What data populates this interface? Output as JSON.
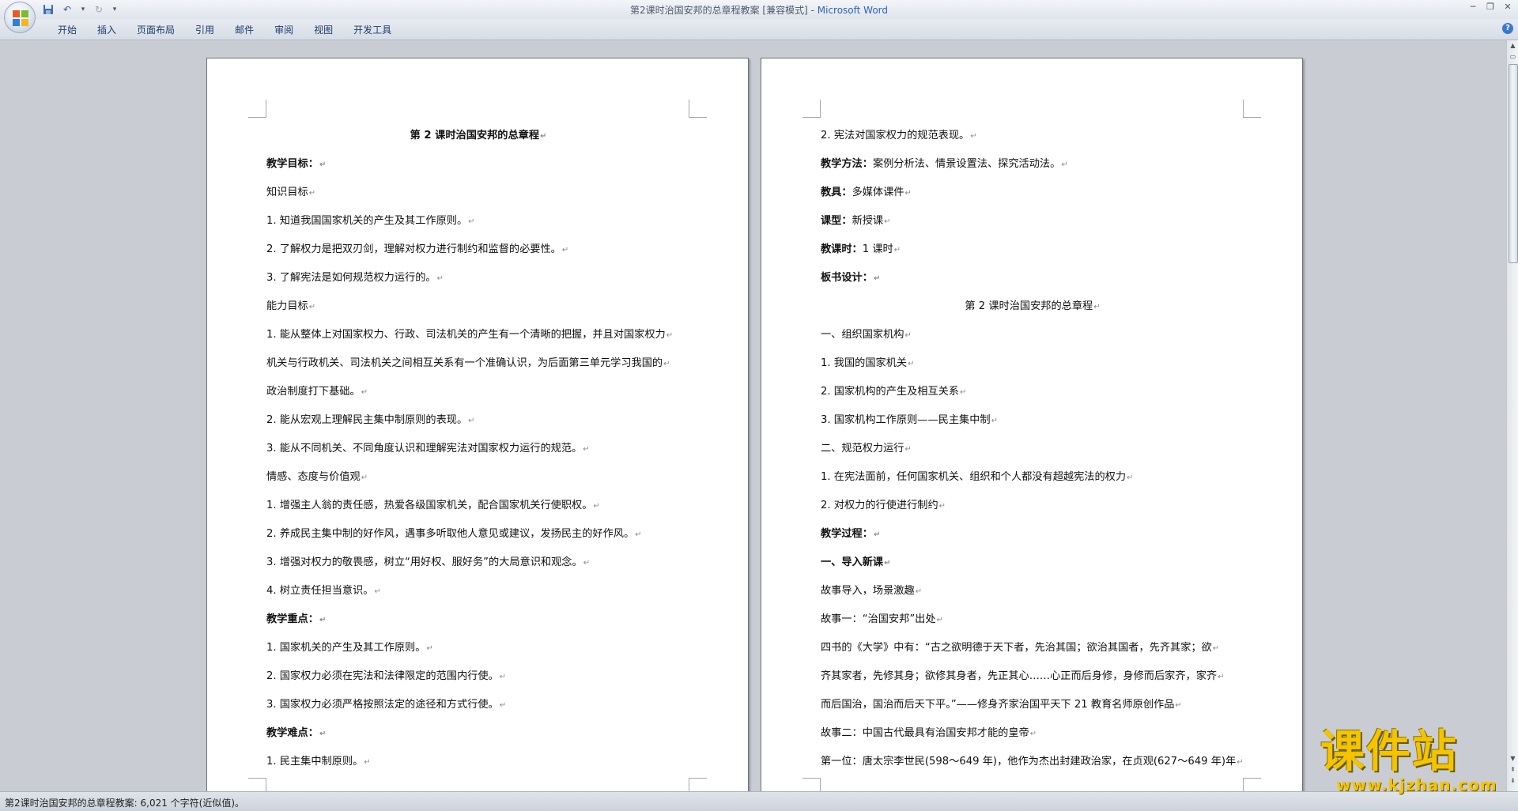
{
  "window": {
    "doc_title": "第2课时治国安邦的总章程教案 [兼容模式]",
    "separator": " - ",
    "app_name": "Microsoft Word"
  },
  "ribbon": {
    "tabs": [
      "开始",
      "插入",
      "页面布局",
      "引用",
      "邮件",
      "审阅",
      "视图",
      "开发工具"
    ]
  },
  "pages": {
    "left": [
      {
        "text": "第 2 课时治国安邦的总章程",
        "bold": true,
        "center": true
      },
      {
        "text": "教学目标：",
        "bold": true
      },
      {
        "text": "知识目标"
      },
      {
        "text": "1. 知道我国国家机关的产生及其工作原则。"
      },
      {
        "text": "2. 了解权力是把双刃剑，理解对权力进行制约和监督的必要性。"
      },
      {
        "text": "3. 了解宪法是如何规范权力运行的。"
      },
      {
        "text": "能力目标"
      },
      {
        "text": "1. 能从整体上对国家权力、行政、司法机关的产生有一个清晰的把握，并且对国家权力"
      },
      {
        "text": "机关与行政机关、司法机关之间相互关系有一个准确认识，为后面第三单元学习我国的"
      },
      {
        "text": "政治制度打下基础。"
      },
      {
        "text": "2. 能从宏观上理解民主集中制原则的表现。"
      },
      {
        "text": "3. 能从不同机关、不同角度认识和理解宪法对国家权力运行的规范。"
      },
      {
        "text": "情感、态度与价值观"
      },
      {
        "text": "1. 增强主人翁的责任感，热爱各级国家机关，配合国家机关行使职权。"
      },
      {
        "text": "2. 养成民主集中制的好作风，遇事多听取他人意见或建议，发扬民主的好作风。"
      },
      {
        "text": "3. 增强对权力的敬畏感，树立“用好权、服好务”的大局意识和观念。"
      },
      {
        "text": "4. 树立责任担当意识。"
      },
      {
        "text": "教学重点：",
        "bold": true
      },
      {
        "text": "1. 国家机关的产生及其工作原则。"
      },
      {
        "text": "2. 国家权力必须在宪法和法律限定的范围内行使。"
      },
      {
        "text": "3. 国家权力必须严格按照法定的途径和方式行使。"
      },
      {
        "text": "教学难点：",
        "bold": true
      },
      {
        "text": "1. 民主集中制原则。"
      }
    ],
    "right": [
      {
        "text": "2. 宪法对国家权力的规范表现。"
      },
      {
        "label": "教学方法：",
        "text": "案例分析法、情景设置法、探究活动法。"
      },
      {
        "label": "教具：",
        "text": "多媒体课件"
      },
      {
        "label": "课型：",
        "text": "新授课"
      },
      {
        "label": "教课时：",
        "text": "1 课时"
      },
      {
        "text": "板书设计：",
        "bold": true
      },
      {
        "text": "第 2 课时治国安邦的总章程",
        "center": true
      },
      {
        "text": "一、组织国家机构"
      },
      {
        "text": "1. 我国的国家机关"
      },
      {
        "text": "2. 国家机构的产生及相互关系"
      },
      {
        "text": "3. 国家机构工作原则——民主集中制"
      },
      {
        "text": "二、规范权力运行"
      },
      {
        "text": "1. 在宪法面前，任何国家机关、组织和个人都没有超越宪法的权力"
      },
      {
        "text": "2. 对权力的行使进行制约"
      },
      {
        "text": "教学过程：",
        "bold": true
      },
      {
        "text": "一、导入新课",
        "bold": true
      },
      {
        "text": "故事导入，场景激趣"
      },
      {
        "text": "故事一：“治国安邦”出处"
      },
      {
        "text": "四书的《大学》中有：“古之欲明德于天下者，先治其国；欲治其国者，先齐其家；欲"
      },
      {
        "text": "齐其家者，先修其身；欲修其身者，先正其心……心正而后身修，身修而后家齐，家齐"
      },
      {
        "text": "而后国治，国治而后天下平。”——修身齐家治国平天下 21 教育名师原创作品"
      },
      {
        "text": "故事二：中国古代最具有治国安邦才能的皇帝"
      },
      {
        "text": "第一位：唐太宗李世民(598～649 年)，他作为杰出封建政治家，在贞观(627～649 年)年"
      }
    ],
    "paragraph_mark": "↵"
  },
  "statusbar": {
    "text": "第2课时治国安邦的总章程教案: 6,021 个字符(近似值)。"
  },
  "watermark": {
    "title": "课件站",
    "url": "www.kjzhan.com"
  },
  "colors": {
    "accent": "#2e64b5",
    "watermark": "#f4c400"
  }
}
